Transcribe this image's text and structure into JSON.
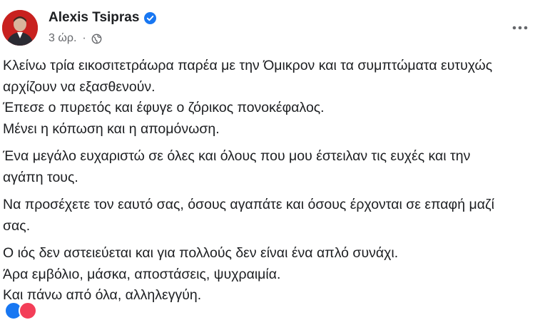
{
  "post": {
    "author": "Alexis Tsipras",
    "verified_icon": "verified-badge-icon",
    "timestamp": "3 ώρ.",
    "separator": "·",
    "audience_icon": "globe-icon",
    "more_icon": "more-options-icon",
    "paragraphs": [
      [
        "Κλείνω τρία εικοσιτετράωρα παρέα με την Όμικρον και τα συμπτώματα ευτυχώς",
        "αρχίζουν να εξασθενούν.",
        "Έπεσε ο πυρετός και έφυγε ο ζόρικος πονοκέφαλος.",
        "Μένει η κόπωση και η απομόνωση."
      ],
      [
        "Ένα μεγάλο ευχαριστώ σε όλες και όλους που μου έστειλαν τις ευχές και την",
        "αγάπη τους."
      ],
      [
        "Να προσέχετε τον εαυτό σας, όσους αγαπάτε και όσους έρχονται σε επαφή μαζί",
        "σας."
      ],
      [
        "Ο ιός δεν αστειεύεται και για πολλούς δεν είναι ένα απλό συνάχι.",
        "Άρα εμβόλιο, μάσκα, αποστάσεις, ψυχραιμία.",
        "Και πάνω από όλα, αλληλεγγύη."
      ]
    ]
  },
  "colors": {
    "text": "#1c1e21",
    "secondary_text": "#65676b",
    "verified_blue": "#1877f2",
    "avatar_red": "#c8211f"
  }
}
